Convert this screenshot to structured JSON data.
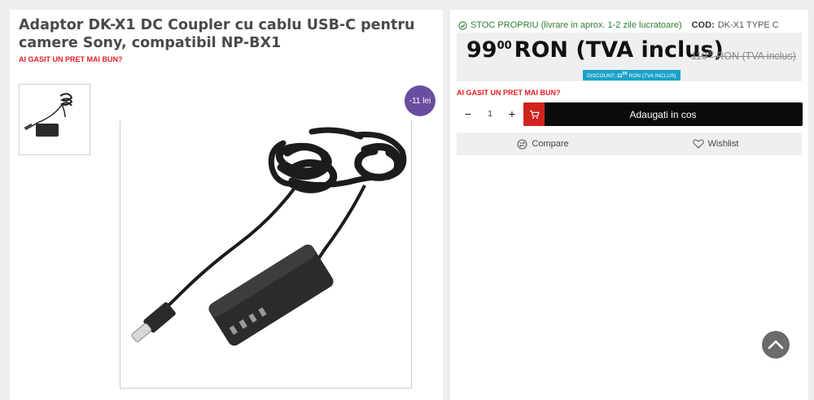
{
  "product": {
    "title": "Adaptor DK-X1 DC Coupler cu cablu USB-C pentru camere Sony, compatibil NP-BX1",
    "better_price": "AI GASIT UN PRET MAI BUN?",
    "discount_badge": "-11 lei",
    "thumbnail_icon": "product-thumbnail",
    "image_icon": "coiled-usb-c-cable-with-dummy-battery"
  },
  "purchase": {
    "stock": "STOC PROPRIU (livrare in aprox. 1-2 zile lucratoare)",
    "code_label": "COD:",
    "code_value": "DK-X1 TYPE C",
    "price_int": "99",
    "price_dec": "00",
    "price_suffix": "RON (TVA inclus)",
    "old_price_int": "110",
    "old_price_dec": "00",
    "old_price_suffix": "RON (TVA inclus)",
    "discount_prefix": "DISCOUNT: ",
    "discount_amount_int": "11",
    "discount_amount_dec": "00",
    "discount_suffix": " RON (TVA INCLUS)",
    "better_price": "AI GASIT UN PRET MAI BUN?",
    "qty_minus": "−",
    "qty_value": "1",
    "qty_plus": "+",
    "add_to_cart": "Adaugati in cos",
    "compare": "Compare",
    "wishlist": "Wishlist"
  },
  "colors": {
    "accent_red": "#e31e24",
    "badge_purple": "#6a4da0",
    "stock_green": "#2e7d32",
    "discount_blue": "#1aa3c9"
  }
}
